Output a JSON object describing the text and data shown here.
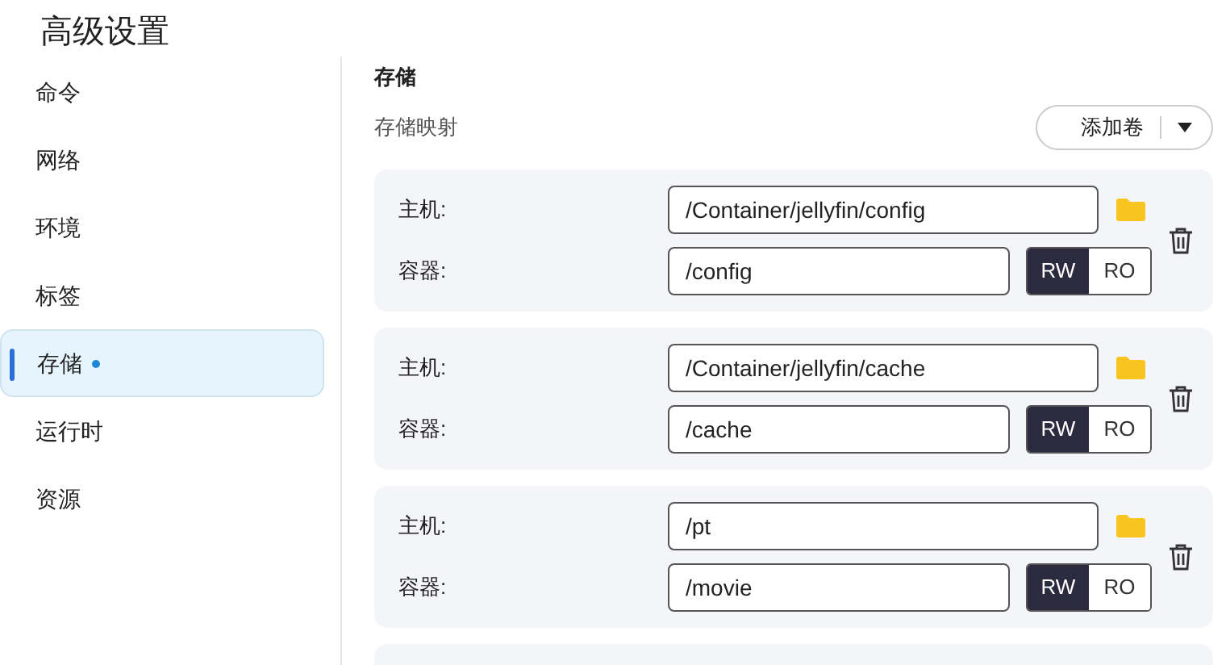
{
  "title": "高级设置",
  "sidebar": {
    "items": [
      {
        "label": "命令",
        "selected": false,
        "modified": false
      },
      {
        "label": "网络",
        "selected": false,
        "modified": false
      },
      {
        "label": "环境",
        "selected": false,
        "modified": false
      },
      {
        "label": "标签",
        "selected": false,
        "modified": false
      },
      {
        "label": "存储",
        "selected": true,
        "modified": true
      },
      {
        "label": "运行时",
        "selected": false,
        "modified": false
      },
      {
        "label": "资源",
        "selected": false,
        "modified": false
      }
    ]
  },
  "section_title": "存储",
  "subsection_title": "存储映射",
  "add_button": {
    "label": "添加卷"
  },
  "mappings": [
    {
      "host_label": "主机:",
      "host_value": "/Container/jellyfin/config",
      "container_label": "容器:",
      "container_value": "/config",
      "modes": [
        {
          "label": "RW",
          "selected": true
        },
        {
          "label": "RO",
          "selected": false
        }
      ]
    },
    {
      "host_label": "主机:",
      "host_value": "/Container/jellyfin/cache",
      "container_label": "容器:",
      "container_value": "/cache",
      "modes": [
        {
          "label": "RW",
          "selected": true
        },
        {
          "label": "RO",
          "selected": false
        }
      ]
    },
    {
      "host_label": "主机:",
      "host_value": "/pt",
      "container_label": "容器:",
      "container_value": "/movie",
      "modes": [
        {
          "label": "RW",
          "selected": true
        },
        {
          "label": "RO",
          "selected": false
        }
      ]
    }
  ]
}
